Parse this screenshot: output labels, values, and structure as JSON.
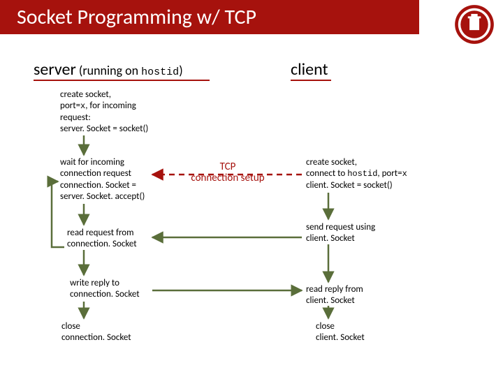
{
  "title": "Socket Programming w/ TCP",
  "server_heading": {
    "main": "server",
    "paren_pre": " (running on ",
    "hostid": "hostid",
    "paren_post": ")"
  },
  "client_heading": "client",
  "server": {
    "create": {
      "l1": "create socket,",
      "l2a": "port=",
      "l2b": "x",
      "l2c": ", for incoming",
      "l3": "request:",
      "l4": "server. Socket = socket()"
    },
    "wait": {
      "l1": "wait for incoming",
      "l2": "connection request",
      "l3": "connection. Socket =",
      "l4": "server. Socket. accept()"
    },
    "read": {
      "l1": "read request from",
      "l2": "connection. Socket"
    },
    "write": {
      "l1": "write reply to",
      "l2": "connection. Socket"
    },
    "close": {
      "l1": "close",
      "l2": "connection. Socket"
    }
  },
  "client": {
    "create": {
      "l1": "create socket,",
      "l2a": "connect to ",
      "l2b": "hostid",
      "l2c": ", port=",
      "l2d": "x",
      "l3": "client. Socket = socket()"
    },
    "send": {
      "l1": "send request using",
      "l2": "client. Socket"
    },
    "read": {
      "l1": "read reply from",
      "l2": "client. Socket"
    },
    "close": {
      "l1": "close",
      "l2": "client. Socket"
    }
  },
  "tcp": {
    "l1": "TCP",
    "l2": "connection setup"
  },
  "colors": {
    "accent": "#a6120d",
    "arrow": "#5a6e3a",
    "dashed": "#a6120d"
  }
}
